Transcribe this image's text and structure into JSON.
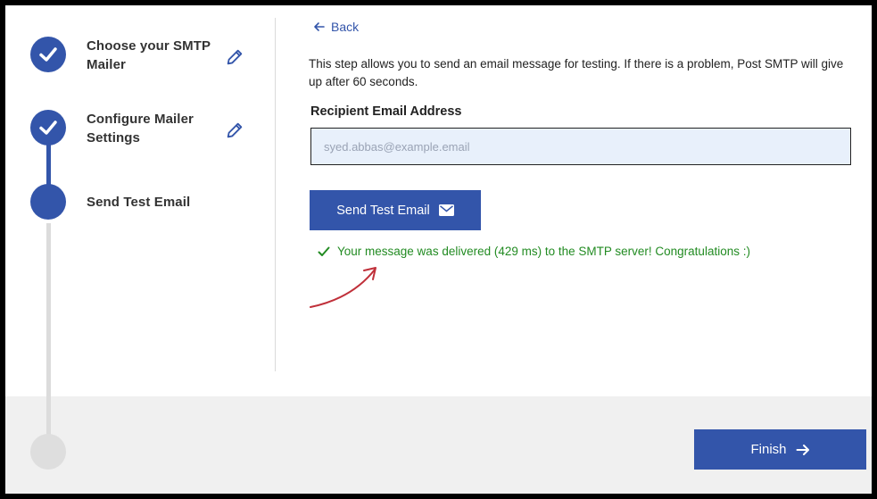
{
  "steps": [
    {
      "label_line1": "Choose your SMTP",
      "label_line2": "Mailer",
      "status": "completed"
    },
    {
      "label_line1": "Configure Mailer",
      "label_line2": "Settings",
      "status": "completed"
    },
    {
      "label_line1": "Send Test Email",
      "label_line2": "",
      "status": "current"
    },
    {
      "label_line1": "",
      "label_line2": "",
      "status": "upcoming"
    }
  ],
  "back": {
    "label": "Back"
  },
  "intro": {
    "text": "This step allows you to send an email message for testing. If there is a problem, Post SMTP will give up after 60 seconds."
  },
  "recipient": {
    "label": "Recipient Email Address",
    "value": "syed.abbas@example.email"
  },
  "send_button": {
    "label": "Send Test Email"
  },
  "result": {
    "message": "Your message was delivered (429 ms) to the SMTP server! Congratulations :)"
  },
  "finish_button": {
    "label": "Finish"
  },
  "colors": {
    "accent": "#3355aa",
    "success": "#228b22",
    "inactive": "#dedede",
    "annotation": "#c0303a"
  },
  "icons": {
    "completed": "check-icon",
    "edit": "pencil-icon",
    "back": "arrow-left-icon",
    "send": "envelope-icon",
    "finish": "arrow-right-icon",
    "success": "checkmark-icon"
  }
}
